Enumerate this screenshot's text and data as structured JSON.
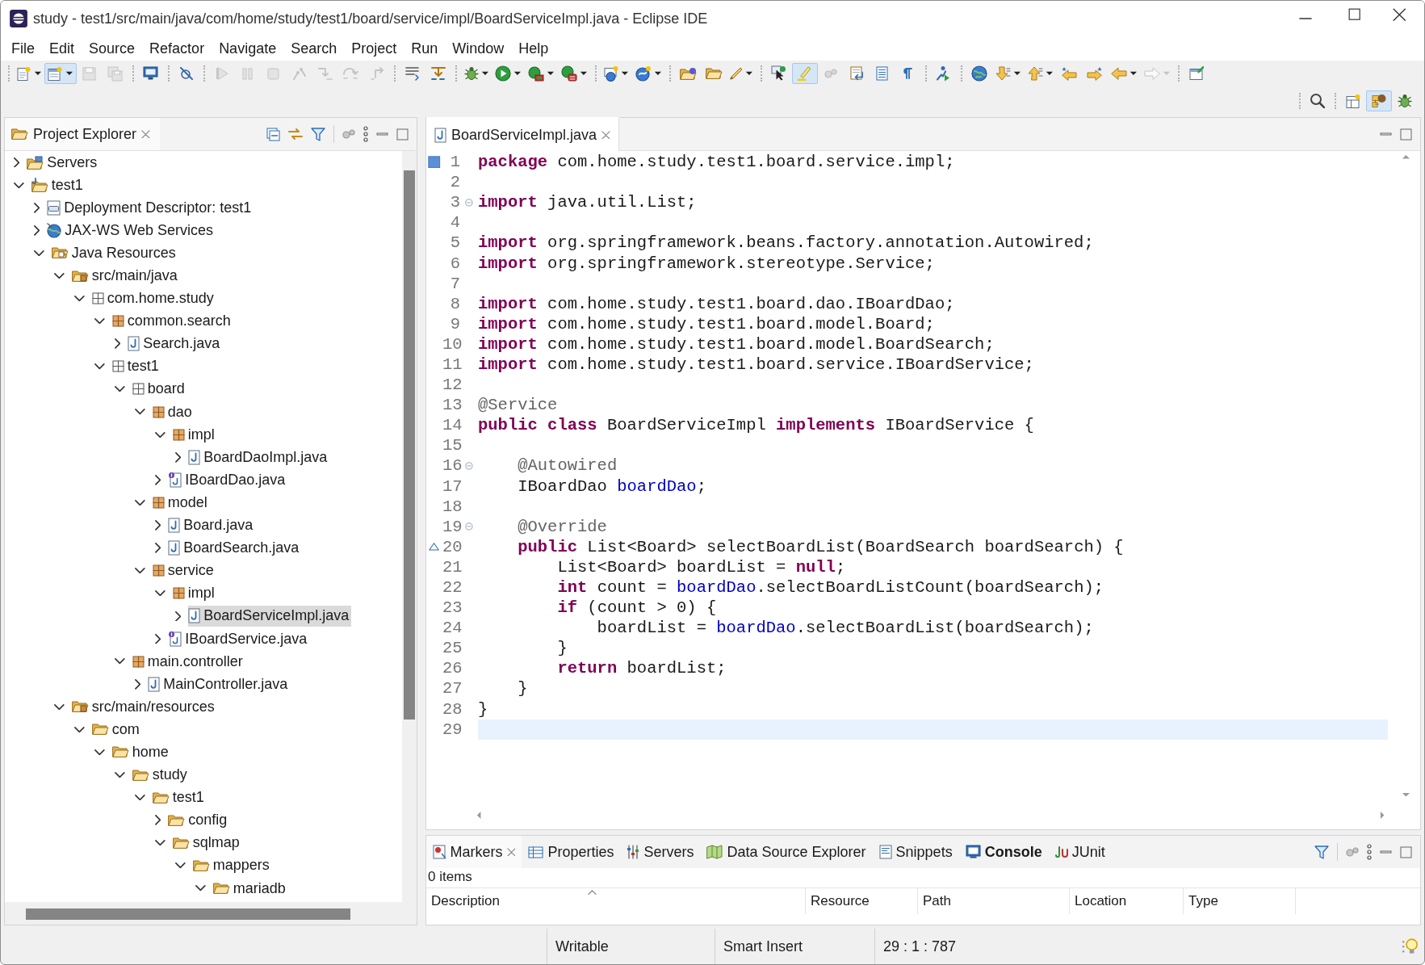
{
  "window": {
    "title": "study - test1/src/main/java/com/home/study/test1/board/service/impl/BoardServiceImpl.java - Eclipse IDE"
  },
  "menu": [
    "File",
    "Edit",
    "Source",
    "Refactor",
    "Navigate",
    "Search",
    "Project",
    "Run",
    "Window",
    "Help"
  ],
  "toolbar": [
    [
      {
        "kind": "doc",
        "dropdown": true,
        "disabled": false,
        "selected": false
      },
      {
        "kind": "form",
        "dropdown": true,
        "disabled": false,
        "selected": true
      },
      {
        "kind": "disk",
        "dropdown": false,
        "disabled": true,
        "selected": false
      },
      {
        "kind": "disks",
        "dropdown": false,
        "disabled": true,
        "selected": false
      }
    ],
    [
      {
        "kind": "monitor",
        "dropdown": false,
        "disabled": false,
        "selected": false
      }
    ],
    [
      {
        "kind": "nobreak",
        "dropdown": false,
        "disabled": false,
        "selected": false
      }
    ],
    [
      {
        "kind": "play",
        "dropdown": false,
        "disabled": true,
        "selected": false
      },
      {
        "kind": "pause",
        "dropdown": false,
        "disabled": true,
        "selected": false
      },
      {
        "kind": "stop",
        "dropdown": false,
        "disabled": true,
        "selected": false
      },
      {
        "kind": "disconnect",
        "dropdown": false,
        "disabled": true,
        "selected": false
      },
      {
        "kind": "step",
        "dropdown": false,
        "disabled": true,
        "selected": false
      },
      {
        "kind": "stepover",
        "dropdown": false,
        "disabled": true,
        "selected": false
      },
      {
        "kind": "stepreturn",
        "dropdown": false,
        "disabled": true,
        "selected": false
      }
    ],
    [
      {
        "kind": "lines",
        "dropdown": false,
        "disabled": false,
        "selected": false
      },
      {
        "kind": "dropframe",
        "dropdown": false,
        "disabled": false,
        "selected": false
      }
    ],
    [
      {
        "kind": "bug",
        "dropdown": true,
        "disabled": false,
        "selected": false
      },
      {
        "kind": "run",
        "dropdown": true,
        "disabled": false,
        "selected": false
      },
      {
        "kind": "coverage",
        "dropdown": true,
        "disabled": false,
        "selected": false
      },
      {
        "kind": "toolbox",
        "dropdown": true,
        "disabled": false,
        "selected": false
      }
    ],
    [
      {
        "kind": "globeplus",
        "dropdown": true,
        "disabled": false,
        "selected": false
      },
      {
        "kind": "sphere",
        "dropdown": true,
        "disabled": false,
        "selected": false
      }
    ],
    [
      {
        "kind": "folderglobe",
        "dropdown": false,
        "disabled": false,
        "selected": false
      },
      {
        "kind": "folder",
        "dropdown": false,
        "disabled": false,
        "selected": false
      },
      {
        "kind": "pen",
        "dropdown": true,
        "disabled": false,
        "selected": false
      }
    ],
    [
      {
        "kind": "pointer",
        "dropdown": false,
        "disabled": false,
        "selected": false
      },
      {
        "kind": "marker",
        "dropdown": false,
        "disabled": false,
        "selected": true
      },
      {
        "kind": "gears",
        "dropdown": false,
        "disabled": true,
        "selected": false
      },
      {
        "kind": "docarrow",
        "dropdown": false,
        "disabled": false,
        "selected": false
      },
      {
        "kind": "doclines",
        "dropdown": false,
        "disabled": false,
        "selected": false
      },
      {
        "kind": "pilcrow",
        "dropdown": false,
        "disabled": false,
        "selected": false
      }
    ],
    [
      {
        "kind": "runner",
        "dropdown": false,
        "disabled": false,
        "selected": false
      }
    ],
    [
      {
        "kind": "globe",
        "dropdown": false,
        "disabled": false,
        "selected": false
      },
      {
        "kind": "adown",
        "dropdown": true,
        "disabled": false,
        "selected": false
      },
      {
        "kind": "aup",
        "dropdown": true,
        "disabled": false,
        "selected": false
      },
      {
        "kind": "starleft",
        "dropdown": false,
        "disabled": false,
        "selected": false
      },
      {
        "kind": "starright",
        "dropdown": false,
        "disabled": false,
        "selected": false
      },
      {
        "kind": "aleft",
        "dropdown": true,
        "disabled": false,
        "selected": false
      },
      {
        "kind": "aright",
        "dropdown": true,
        "disabled": true,
        "selected": false
      }
    ],
    [
      {
        "kind": "window",
        "dropdown": false,
        "disabled": false,
        "selected": false
      }
    ]
  ],
  "toolbar_right": [
    [
      {
        "kind": "search",
        "dropdown": false,
        "disabled": false,
        "selected": false
      }
    ],
    [
      {
        "kind": "perspective",
        "dropdown": false,
        "disabled": false,
        "selected": false
      },
      {
        "kind": "javap",
        "dropdown": false,
        "disabled": false,
        "selected": true
      },
      {
        "kind": "bug",
        "dropdown": false,
        "disabled": false,
        "selected": false
      }
    ]
  ],
  "project_explorer": {
    "title": "Project Explorer",
    "tree": [
      {
        "label": "Servers",
        "kind": "server-folder",
        "expanded": false,
        "selected": false
      },
      {
        "label": "test1",
        "kind": "project",
        "expanded": true,
        "selected": false,
        "children": [
          {
            "label": "Deployment Descriptor: test1",
            "kind": "descriptor",
            "expanded": false,
            "selected": false
          },
          {
            "label": "JAX-WS Web Services",
            "kind": "web-services",
            "expanded": false,
            "selected": false
          },
          {
            "label": "Java Resources",
            "kind": "library",
            "expanded": true,
            "selected": false,
            "children": [
              {
                "label": "src/main/java",
                "kind": "source-folder",
                "expanded": true,
                "selected": false,
                "children": [
                  {
                    "label": "com.home.study",
                    "kind": "empty-package",
                    "expanded": true,
                    "selected": false,
                    "children": [
                      {
                        "label": "common.search",
                        "kind": "package",
                        "expanded": true,
                        "selected": false,
                        "children": [
                          {
                            "label": "Search.java",
                            "kind": "java-file",
                            "expanded": false,
                            "selected": false
                          }
                        ]
                      },
                      {
                        "label": "test1",
                        "kind": "empty-package",
                        "expanded": true,
                        "selected": false,
                        "children": [
                          {
                            "label": "board",
                            "kind": "empty-package",
                            "expanded": true,
                            "selected": false,
                            "children": [
                              {
                                "label": "dao",
                                "kind": "package",
                                "expanded": true,
                                "selected": false,
                                "children": [
                                  {
                                    "label": "impl",
                                    "kind": "package",
                                    "expanded": true,
                                    "selected": false,
                                    "children": [
                                      {
                                        "label": "BoardDaoImpl.java",
                                        "kind": "java-file",
                                        "expanded": false,
                                        "selected": false
                                      }
                                    ]
                                  },
                                  {
                                    "label": "IBoardDao.java",
                                    "kind": "interface-file",
                                    "expanded": false,
                                    "selected": false
                                  }
                                ]
                              },
                              {
                                "label": "model",
                                "kind": "package",
                                "expanded": true,
                                "selected": false,
                                "children": [
                                  {
                                    "label": "Board.java",
                                    "kind": "java-file",
                                    "expanded": false,
                                    "selected": false
                                  },
                                  {
                                    "label": "BoardSearch.java",
                                    "kind": "java-file",
                                    "expanded": false,
                                    "selected": false
                                  }
                                ]
                              },
                              {
                                "label": "service",
                                "kind": "package",
                                "expanded": true,
                                "selected": false,
                                "children": [
                                  {
                                    "label": "impl",
                                    "kind": "package",
                                    "expanded": true,
                                    "selected": false,
                                    "children": [
                                      {
                                        "label": "BoardServiceImpl.java",
                                        "kind": "java-file",
                                        "expanded": false,
                                        "selected": true
                                      }
                                    ]
                                  },
                                  {
                                    "label": "IBoardService.java",
                                    "kind": "interface-file",
                                    "expanded": false,
                                    "selected": false
                                  }
                                ]
                              }
                            ]
                          },
                          {
                            "label": "main.controller",
                            "kind": "package",
                            "expanded": true,
                            "selected": false,
                            "children": [
                              {
                                "label": "MainController.java",
                                "kind": "java-file",
                                "expanded": false,
                                "selected": false
                              }
                            ]
                          }
                        ]
                      }
                    ]
                  }
                ]
              },
              {
                "label": "src/main/resources",
                "kind": "source-folder",
                "expanded": true,
                "selected": false,
                "children": [
                  {
                    "label": "com",
                    "kind": "folder",
                    "expanded": true,
                    "selected": false,
                    "children": [
                      {
                        "label": "home",
                        "kind": "folder",
                        "expanded": true,
                        "selected": false,
                        "children": [
                          {
                            "label": "study",
                            "kind": "folder",
                            "expanded": true,
                            "selected": false,
                            "children": [
                              {
                                "label": "test1",
                                "kind": "folder",
                                "expanded": true,
                                "selected": false,
                                "children": [
                                  {
                                    "label": "config",
                                    "kind": "folder",
                                    "expanded": false,
                                    "selected": false
                                  },
                                  {
                                    "label": "sqlmap",
                                    "kind": "folder",
                                    "expanded": true,
                                    "selected": false,
                                    "children": [
                                      {
                                        "label": "mappers",
                                        "kind": "folder",
                                        "expanded": true,
                                        "selected": false,
                                        "children": [
                                          {
                                            "label": "mariadb",
                                            "kind": "folder",
                                            "expanded": true,
                                            "selected": false
                                          }
                                        ]
                                      }
                                    ]
                                  }
                                ]
                              }
                            ]
                          }
                        ]
                      }
                    ]
                  }
                ]
              }
            ]
          }
        ]
      }
    ]
  },
  "editor": {
    "tabs": [
      {
        "label": "BoardServiceImpl.java",
        "selected": true
      }
    ],
    "lines": [
      {
        "n": "1",
        "kind": "occurrence",
        "fold": false,
        "current": false,
        "tokens": [
          {
            "kind": "kw",
            "text": "package"
          },
          {
            "kind": "plain",
            "text": " com.home.study.test1.board.service.impl;"
          }
        ]
      },
      {
        "n": "2",
        "kind": "line",
        "fold": false,
        "current": false
      },
      {
        "n": "3",
        "kind": "line",
        "fold": true,
        "current": false,
        "tokens": [
          {
            "kind": "kw",
            "text": "import"
          },
          {
            "kind": "plain",
            "text": " java.util.List;"
          }
        ]
      },
      {
        "n": "4",
        "kind": "line",
        "fold": false,
        "current": false
      },
      {
        "n": "5",
        "kind": "line",
        "fold": false,
        "current": false,
        "tokens": [
          {
            "kind": "kw",
            "text": "import"
          },
          {
            "kind": "plain",
            "text": " org.springframework.beans.factory.annotation.Autowired;"
          }
        ]
      },
      {
        "n": "6",
        "kind": "line",
        "fold": false,
        "current": false,
        "tokens": [
          {
            "kind": "kw",
            "text": "import"
          },
          {
            "kind": "plain",
            "text": " org.springframework.stereotype.Service;"
          }
        ]
      },
      {
        "n": "7",
        "kind": "line",
        "fold": false,
        "current": false
      },
      {
        "n": "8",
        "kind": "line",
        "fold": false,
        "current": false,
        "tokens": [
          {
            "kind": "kw",
            "text": "import"
          },
          {
            "kind": "plain",
            "text": " com.home.study.test1.board.dao.IBoardDao;"
          }
        ]
      },
      {
        "n": "9",
        "kind": "line",
        "fold": false,
        "current": false,
        "tokens": [
          {
            "kind": "kw",
            "text": "import"
          },
          {
            "kind": "plain",
            "text": " com.home.study.test1.board.model.Board;"
          }
        ]
      },
      {
        "n": "10",
        "kind": "line",
        "fold": false,
        "current": false,
        "tokens": [
          {
            "kind": "kw",
            "text": "import"
          },
          {
            "kind": "plain",
            "text": " com.home.study.test1.board.model.BoardSearch;"
          }
        ]
      },
      {
        "n": "11",
        "kind": "line",
        "fold": false,
        "current": false,
        "tokens": [
          {
            "kind": "kw",
            "text": "import"
          },
          {
            "kind": "plain",
            "text": " com.home.study.test1.board.service.IBoardService;"
          }
        ]
      },
      {
        "n": "12",
        "kind": "line",
        "fold": false,
        "current": false
      },
      {
        "n": "13",
        "kind": "line",
        "fold": false,
        "current": false,
        "tokens": [
          {
            "kind": "ann",
            "text": "@Service"
          }
        ]
      },
      {
        "n": "14",
        "kind": "line",
        "fold": false,
        "current": false,
        "tokens": [
          {
            "kind": "kw",
            "text": "public class"
          },
          {
            "kind": "plain",
            "text": " BoardServiceImpl "
          },
          {
            "kind": "kw",
            "text": "implements"
          },
          {
            "kind": "plain",
            "text": " IBoardService {"
          }
        ]
      },
      {
        "n": "15",
        "kind": "line",
        "fold": false,
        "current": false
      },
      {
        "n": "16",
        "kind": "line",
        "fold": true,
        "current": false,
        "tokens": [
          {
            "kind": "ann",
            "text": "    @Autowired"
          }
        ]
      },
      {
        "n": "17",
        "kind": "line",
        "fold": false,
        "current": false,
        "tokens": [
          {
            "kind": "plain",
            "text": "    IBoardDao "
          },
          {
            "kind": "field",
            "text": "boardDao"
          },
          {
            "kind": "plain",
            "text": ";"
          }
        ]
      },
      {
        "n": "18",
        "kind": "line",
        "fold": false,
        "current": false
      },
      {
        "n": "19",
        "kind": "line",
        "fold": true,
        "current": false,
        "tokens": [
          {
            "kind": "ann",
            "text": "    @Override"
          }
        ]
      },
      {
        "n": "20",
        "kind": "override",
        "fold": false,
        "current": false,
        "tokens": [
          {
            "kind": "kw",
            "text": "    public"
          },
          {
            "kind": "plain",
            "text": " List<Board> selectBoardList(BoardSearch boardSearch) {"
          }
        ]
      },
      {
        "n": "21",
        "kind": "line",
        "fold": false,
        "current": false,
        "tokens": [
          {
            "kind": "plain",
            "text": "        List<Board> boardList = "
          },
          {
            "kind": "kw",
            "text": "null"
          },
          {
            "kind": "plain",
            "text": ";"
          }
        ]
      },
      {
        "n": "22",
        "kind": "line",
        "fold": false,
        "current": false,
        "tokens": [
          {
            "kind": "kw",
            "text": "        int"
          },
          {
            "kind": "plain",
            "text": " count = "
          },
          {
            "kind": "field",
            "text": "boardDao"
          },
          {
            "kind": "plain",
            "text": ".selectBoardListCount(boardSearch);"
          }
        ]
      },
      {
        "n": "23",
        "kind": "line",
        "fold": false,
        "current": false,
        "tokens": [
          {
            "kind": "kw",
            "text": "        if"
          },
          {
            "kind": "plain",
            "text": " (count > 0) {"
          }
        ]
      },
      {
        "n": "24",
        "kind": "line",
        "fold": false,
        "current": false,
        "tokens": [
          {
            "kind": "plain",
            "text": "            boardList = "
          },
          {
            "kind": "field",
            "text": "boardDao"
          },
          {
            "kind": "plain",
            "text": ".selectBoardList(boardSearch);"
          }
        ]
      },
      {
        "n": "25",
        "kind": "line",
        "fold": false,
        "current": false,
        "tokens": [
          {
            "kind": "plain",
            "text": "        }"
          }
        ]
      },
      {
        "n": "26",
        "kind": "line",
        "fold": false,
        "current": false,
        "tokens": [
          {
            "kind": "kw",
            "text": "        return"
          },
          {
            "kind": "plain",
            "text": " boardList;"
          }
        ]
      },
      {
        "n": "27",
        "kind": "line",
        "fold": false,
        "current": false,
        "tokens": [
          {
            "kind": "plain",
            "text": "    }"
          }
        ]
      },
      {
        "n": "28",
        "kind": "line",
        "fold": false,
        "current": false,
        "tokens": [
          {
            "kind": "plain",
            "text": "}"
          }
        ]
      },
      {
        "n": "29",
        "kind": "line",
        "fold": false,
        "current": true
      }
    ]
  },
  "bottom_panel": {
    "tabs": [
      {
        "label": "Markers",
        "kind": "markers",
        "selected": true,
        "busy": false
      },
      {
        "label": "Properties",
        "kind": "properties",
        "selected": false,
        "busy": false
      },
      {
        "label": "Servers",
        "kind": "servers",
        "selected": false,
        "busy": false
      },
      {
        "label": "Data Source Explorer",
        "kind": "datasource",
        "selected": false,
        "busy": false
      },
      {
        "label": "Snippets",
        "kind": "snippets",
        "selected": false,
        "busy": false
      },
      {
        "label": "Console",
        "kind": "console",
        "selected": false,
        "busy": true
      },
      {
        "label": "JUnit",
        "kind": "junit",
        "selected": false,
        "busy": false
      }
    ],
    "summary": "0 items",
    "columns": [
      {
        "label": "Description",
        "sorted": true
      },
      {
        "label": "Resource",
        "sorted": false
      },
      {
        "label": "Path",
        "sorted": false
      },
      {
        "label": "Location",
        "sorted": false
      },
      {
        "label": "Type",
        "sorted": false
      }
    ]
  },
  "status_bar": [
    "Writable",
    "Smart Insert",
    "29 : 1 : 787"
  ]
}
